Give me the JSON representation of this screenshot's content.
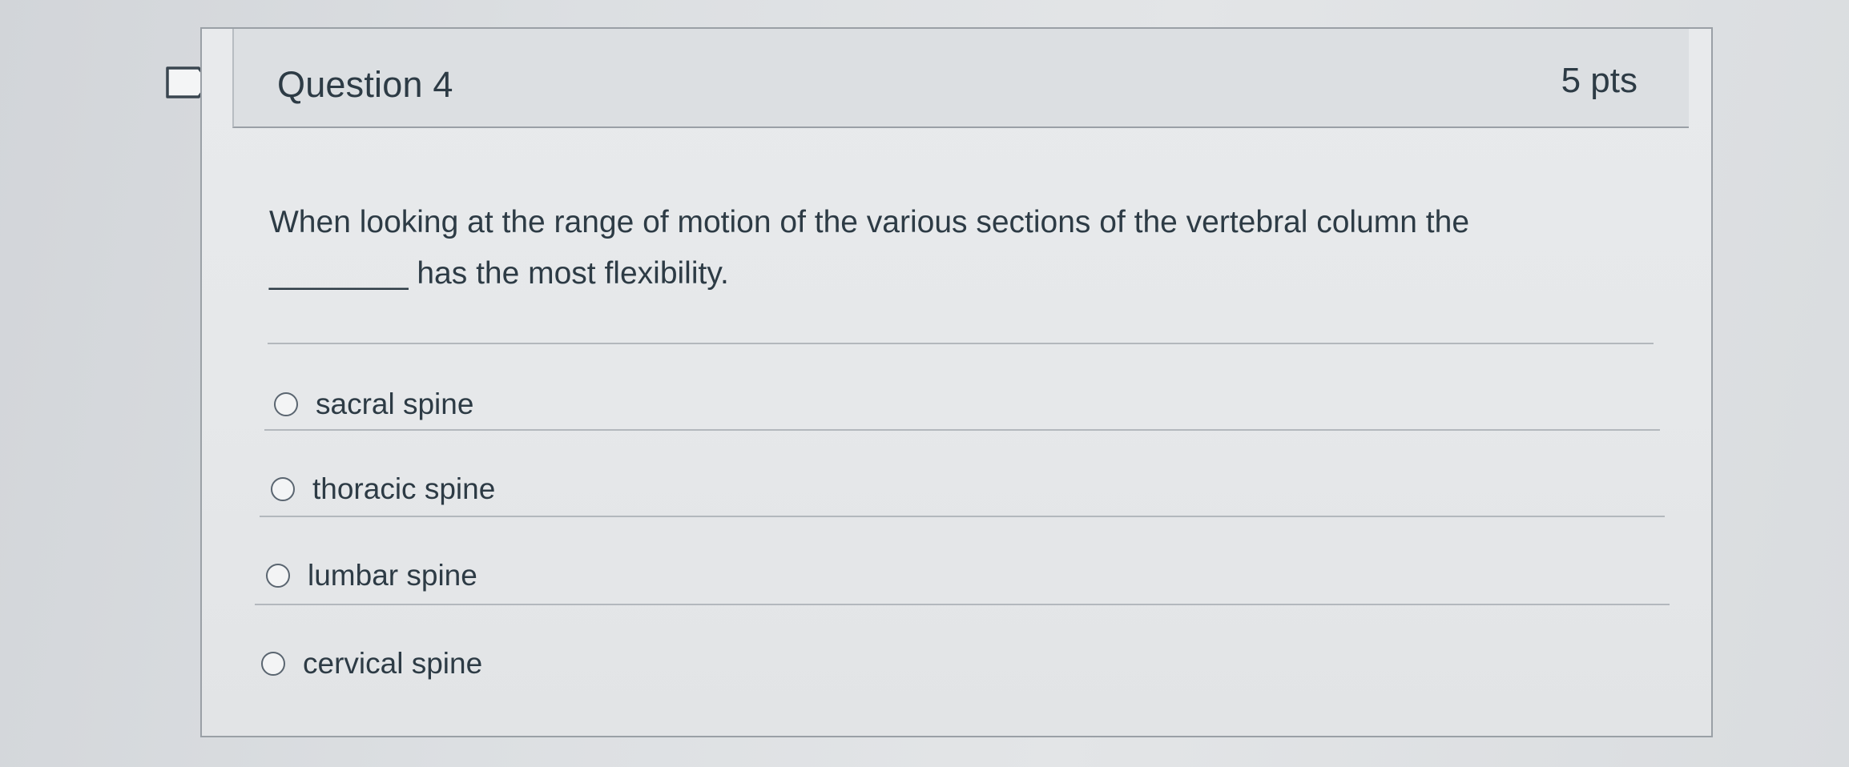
{
  "question": {
    "title": "Question 4",
    "points": "5 pts",
    "text_line1": "When looking at the range of motion of the various sections of the vertebral column the",
    "text_line2": "________ has the most flexibility.",
    "answers": [
      {
        "label": "sacral spine"
      },
      {
        "label": "thoracic spine"
      },
      {
        "label": "lumbar spine"
      },
      {
        "label": "cervical spine"
      }
    ]
  },
  "icons": {
    "flag": "bookmark-flag-icon",
    "radio": "radio-button-icon"
  },
  "colors": {
    "text": "#2d3b45",
    "border": "#9aa0a6",
    "header_bg": "#dcdfe2"
  }
}
